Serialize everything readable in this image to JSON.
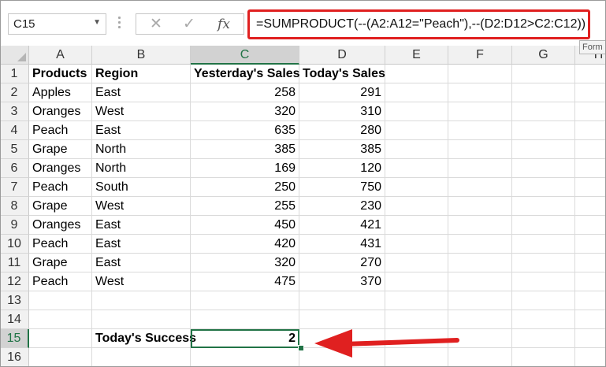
{
  "name_box": {
    "value": "C15",
    "dropdown_icon": "chevron-down-icon"
  },
  "formula_bar": {
    "cancel_icon": "close-icon",
    "enter_icon": "check-icon",
    "function_label": "fx",
    "formula": "=SUMPRODUCT(--(A2:A12=\"Peach\"),--(D2:D12>C2:C12))",
    "tooltip": "Form"
  },
  "columns": [
    "A",
    "B",
    "C",
    "D",
    "E",
    "F",
    "G",
    "H"
  ],
  "active_column": "C",
  "active_row": "15",
  "rows": [
    {
      "n": "1",
      "a": "Products",
      "b": "Region",
      "c": "Yesterday's Sales",
      "d": "Today's Sales"
    },
    {
      "n": "2",
      "a": "Apples",
      "b": "East",
      "c": "258",
      "d": "291"
    },
    {
      "n": "3",
      "a": "Oranges",
      "b": "West",
      "c": "320",
      "d": "310"
    },
    {
      "n": "4",
      "a": "Peach",
      "b": "East",
      "c": "635",
      "d": "280"
    },
    {
      "n": "5",
      "a": "Grape",
      "b": "North",
      "c": "385",
      "d": "385"
    },
    {
      "n": "6",
      "a": "Oranges",
      "b": "North",
      "c": "169",
      "d": "120"
    },
    {
      "n": "7",
      "a": "Peach",
      "b": "South",
      "c": "250",
      "d": "750"
    },
    {
      "n": "8",
      "a": "Grape",
      "b": "West",
      "c": "255",
      "d": "230"
    },
    {
      "n": "9",
      "a": "Oranges",
      "b": "East",
      "c": "450",
      "d": "421"
    },
    {
      "n": "10",
      "a": "Peach",
      "b": "East",
      "c": "420",
      "d": "431"
    },
    {
      "n": "11",
      "a": "Grape",
      "b": "East",
      "c": "320",
      "d": "270"
    },
    {
      "n": "12",
      "a": "Peach",
      "b": "West",
      "c": "475",
      "d": "370"
    },
    {
      "n": "13",
      "a": "",
      "b": "",
      "c": "",
      "d": ""
    },
    {
      "n": "14",
      "a": "",
      "b": "",
      "c": "",
      "d": ""
    },
    {
      "n": "15",
      "a": "",
      "b": "Today's Success",
      "c": "2",
      "d": ""
    },
    {
      "n": "16",
      "a": "",
      "b": "",
      "c": "",
      "d": ""
    }
  ],
  "annotation": {
    "arrow_color": "#e02020",
    "icon": "red-arrow-icon"
  },
  "colors": {
    "accent": "#217346",
    "highlight": "#e02020"
  }
}
